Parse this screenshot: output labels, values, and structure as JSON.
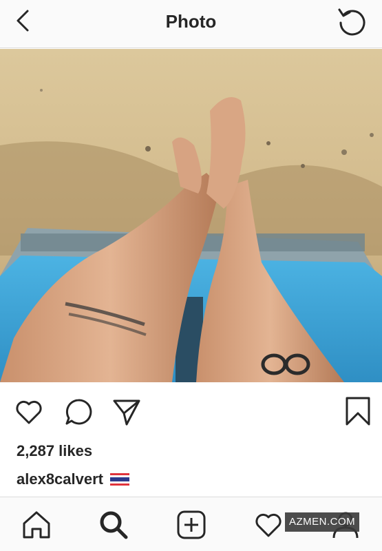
{
  "header": {
    "title": "Photo",
    "back_icon": "chevron-left-icon",
    "refresh_icon": "refresh-icon"
  },
  "post": {
    "likes_text": "2,287 likes",
    "username": "alex8calvert",
    "flag_icon": "thailand-flag-icon"
  },
  "actions": {
    "icons": [
      "heart-icon",
      "comment-icon",
      "share-icon",
      "bookmark-icon"
    ]
  },
  "bottom_nav": {
    "icons": [
      "home-icon",
      "search-icon",
      "add-post-icon",
      "activity-heart-icon",
      "profile-icon"
    ]
  },
  "watermark": {
    "text": "AZMEN.COM"
  },
  "colors": {
    "text": "#262626",
    "header_bg": "#fafafa",
    "divider": "#dbdbdb",
    "lounger_blue": "#3fa6d8",
    "sand": "#d4bd8f"
  }
}
